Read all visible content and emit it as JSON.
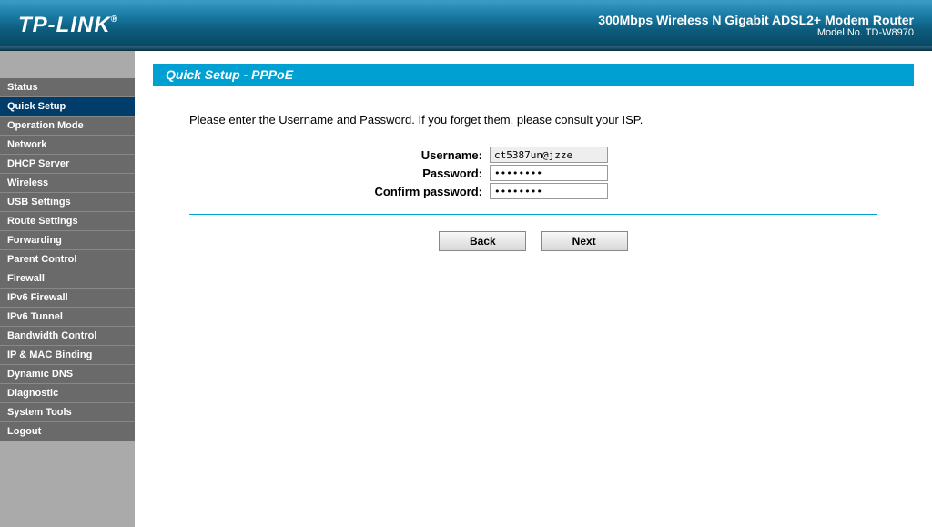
{
  "header": {
    "logo": "TP-LINK",
    "product_name": "300Mbps Wireless N Gigabit ADSL2+ Modem Router",
    "model_no": "Model No. TD-W8970"
  },
  "sidebar": {
    "items": [
      {
        "label": "Status",
        "active": false
      },
      {
        "label": "Quick Setup",
        "active": true
      },
      {
        "label": "Operation Mode",
        "active": false
      },
      {
        "label": "Network",
        "active": false
      },
      {
        "label": "DHCP Server",
        "active": false
      },
      {
        "label": "Wireless",
        "active": false
      },
      {
        "label": "USB Settings",
        "active": false
      },
      {
        "label": "Route Settings",
        "active": false
      },
      {
        "label": "Forwarding",
        "active": false
      },
      {
        "label": "Parent Control",
        "active": false
      },
      {
        "label": "Firewall",
        "active": false
      },
      {
        "label": "IPv6 Firewall",
        "active": false
      },
      {
        "label": "IPv6 Tunnel",
        "active": false
      },
      {
        "label": "Bandwidth Control",
        "active": false
      },
      {
        "label": "IP & MAC Binding",
        "active": false
      },
      {
        "label": "Dynamic DNS",
        "active": false
      },
      {
        "label": "Diagnostic",
        "active": false
      },
      {
        "label": "System Tools",
        "active": false
      },
      {
        "label": "Logout",
        "active": false
      }
    ]
  },
  "main": {
    "title": "Quick Setup - PPPoE",
    "instruction": "Please enter the Username and Password. If you forget them, please consult your ISP.",
    "form": {
      "username_label": "Username:",
      "username_value": "ct5387un@jzze",
      "password_label": "Password:",
      "password_value": "••••••••",
      "confirm_label": "Confirm password:",
      "confirm_value": "••••••••"
    },
    "buttons": {
      "back": "Back",
      "next": "Next"
    }
  }
}
